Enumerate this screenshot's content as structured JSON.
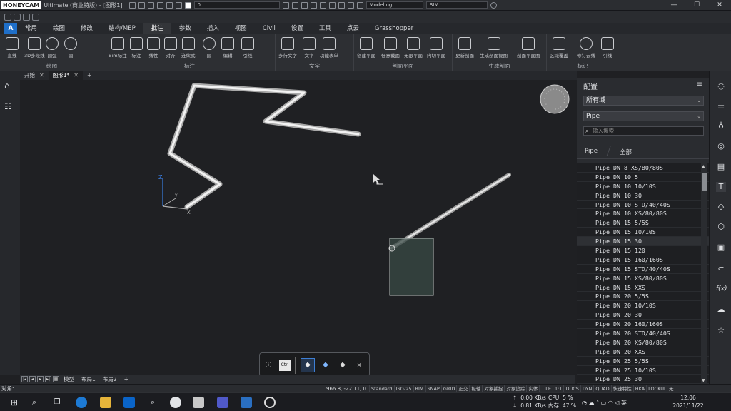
{
  "titlebar": {
    "logo": "HONEYCAM",
    "title": "Ultimate (商业特版) - [图形1]",
    "quick_select_layer": "0",
    "workspace": "Modeling",
    "style": "BIM",
    "window_controls": [
      "—",
      "☐",
      "✕"
    ]
  },
  "menubar": {
    "app_button": "A",
    "items": [
      "常用",
      "绘图",
      "修改",
      "结构/MEP",
      "批注",
      "参数",
      "插入",
      "视图",
      "Civil",
      "设置",
      "工具",
      "点云",
      "Grasshopper"
    ],
    "active_index": 4
  },
  "ribbon": {
    "groups": [
      {
        "label": "绘图",
        "buttons": [
          "直线",
          "3D多段线",
          "圆弧",
          "圆"
        ]
      },
      {
        "label": "标注",
        "buttons": [
          "Bim标注",
          "标注",
          "线性",
          "对齐",
          "连续式",
          "圆",
          "编辑",
          "引线"
        ]
      },
      {
        "label": "文字",
        "buttons": [
          "多行文字",
          "文字",
          "功能表单"
        ]
      },
      {
        "label": "剖面平面",
        "buttons": [
          "创建平面",
          "任意截面",
          "无限平面",
          "内切平面"
        ]
      },
      {
        "label": "生成剖面",
        "buttons": [
          "更新剖面",
          "生成剖面视图",
          "剖面平面图"
        ]
      },
      {
        "label": "标记",
        "buttons": [
          "区域覆盖",
          "修订云线",
          "引线"
        ]
      }
    ]
  },
  "doctabs": {
    "items": [
      "开始",
      "图形1*"
    ],
    "active_index": 1,
    "add": "+"
  },
  "canvas": {
    "ucs_x": "X",
    "ucs_y": "Y",
    "ucs_z": "Z"
  },
  "layouttabs": {
    "items": [
      "模型",
      "布局1",
      "布局2"
    ],
    "add": "+"
  },
  "statusbar": {
    "prompt": "对角:",
    "coordinates": "966.8, -22.11, 0",
    "items": [
      "Standard",
      "ISO-25",
      "BIM",
      "SNAP",
      "GRID",
      "正交",
      "极轴",
      "对象捕捉",
      "对象追踪",
      "实体",
      "TILE",
      "1:1",
      "DUCS",
      "DYN",
      "QUAD",
      "快速特性",
      "HKA",
      "LOCKUI",
      "无"
    ]
  },
  "panel": {
    "title": "配置",
    "filter_scope": "所有域",
    "category": "Pipe",
    "search_placeholder": "输入搜索",
    "tabs": [
      "Pipe",
      "全部"
    ],
    "items": [
      "Pipe DN 8 XS/80/80S",
      "Pipe DN 10 5",
      "Pipe DN 10 10/10S",
      "Pipe DN 10 30",
      "Pipe DN 10 STD/40/40S",
      "Pipe DN 10 XS/80/80S",
      "Pipe DN 15 5/5S",
      "Pipe DN 15 10/10S",
      "Pipe DN 15 30",
      "Pipe DN 15 120",
      "Pipe DN 15 160/160S",
      "Pipe DN 15 STD/40/40S",
      "Pipe DN 15 XS/80/80S",
      "Pipe DN 15 XXS",
      "Pipe DN 20 5/5S",
      "Pipe DN 20 10/10S",
      "Pipe DN 20 30",
      "Pipe DN 20 160/160S",
      "Pipe DN 20 STD/40/40S",
      "Pipe DN 20 XS/80/80S",
      "Pipe DN 20 XXS",
      "Pipe DN 25 5/5S",
      "Pipe DN 25 10/10S",
      "Pipe DN 25 30"
    ],
    "selected_index": 8
  },
  "floatbar": {
    "info": "ⓘ",
    "ctrl": "Ctrl",
    "close": "×"
  },
  "taskbar": {
    "net_up": "↑: 0.00 KB/s",
    "net_down": "↓: 0.81 KB/s",
    "cpu": "CPU: 5 %",
    "mem": "内存: 47 %",
    "ime": "英",
    "time": "12:06",
    "date": "2021/11/22"
  }
}
